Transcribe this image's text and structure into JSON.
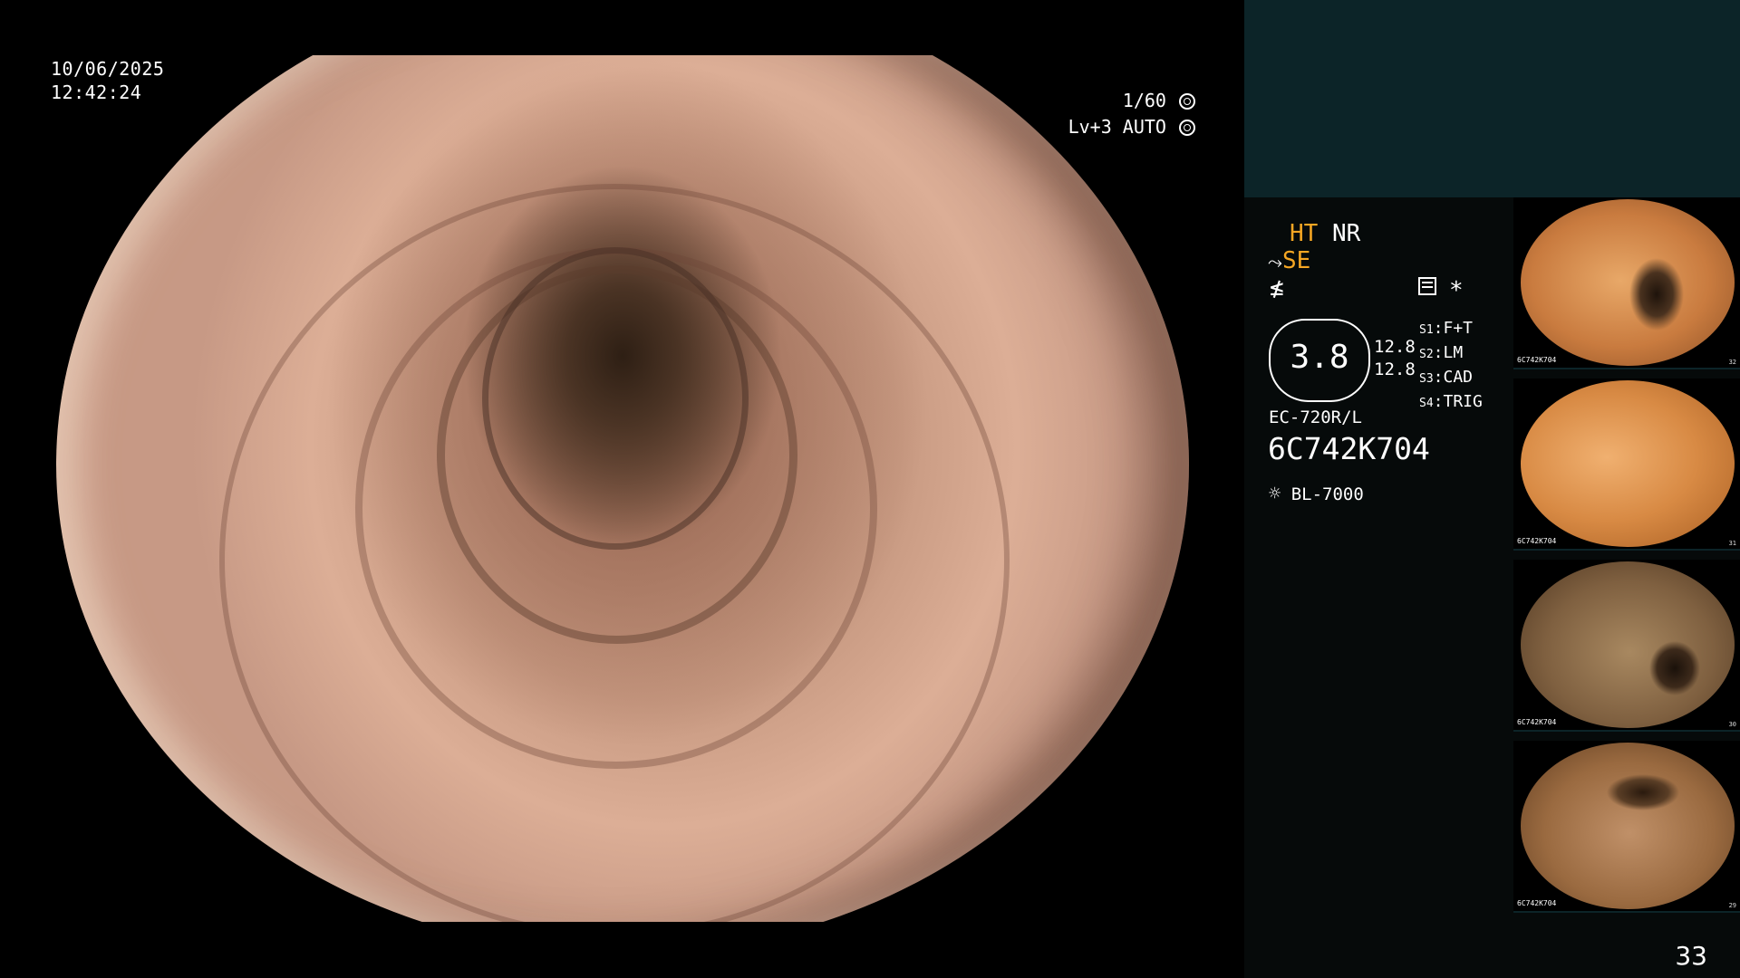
{
  "overlay": {
    "date": "10/06/2025",
    "time": "12:42:24",
    "shutter": "1/60",
    "exposure": "Lv+3 AUTO"
  },
  "panel": {
    "ht": "HT",
    "nr": "NR",
    "se": "SE",
    "asterisk": "*",
    "gauge_value": "3.8",
    "side_values": [
      "12.8",
      "12.8"
    ],
    "modes": [
      {
        "key": "S1",
        "label": "F+T"
      },
      {
        "key": "S2",
        "label": "LM"
      },
      {
        "key": "S3",
        "label": "CAD"
      },
      {
        "key": "S4",
        "label": "TRIG"
      }
    ],
    "scope_model": "EC-720R/L",
    "serial": "6C742K704",
    "light_source": "BL-7000",
    "page_number": "33"
  },
  "thumbnails": [
    {
      "serial": "6C742K704",
      "index": "32"
    },
    {
      "serial": "6C742K704",
      "index": "31"
    },
    {
      "serial": "6C742K704",
      "index": "30"
    },
    {
      "serial": "6C742K704",
      "index": "29"
    }
  ],
  "colors": {
    "panel_top": "#0c2428",
    "panel_bg": "#060a0a",
    "accent": "#f5a623",
    "tissue": "#c89a82"
  },
  "icons": [
    "shutter-icon",
    "auto-exposure-icon",
    "pen-icon",
    "flash-icon",
    "memo-icon",
    "light-icon"
  ]
}
